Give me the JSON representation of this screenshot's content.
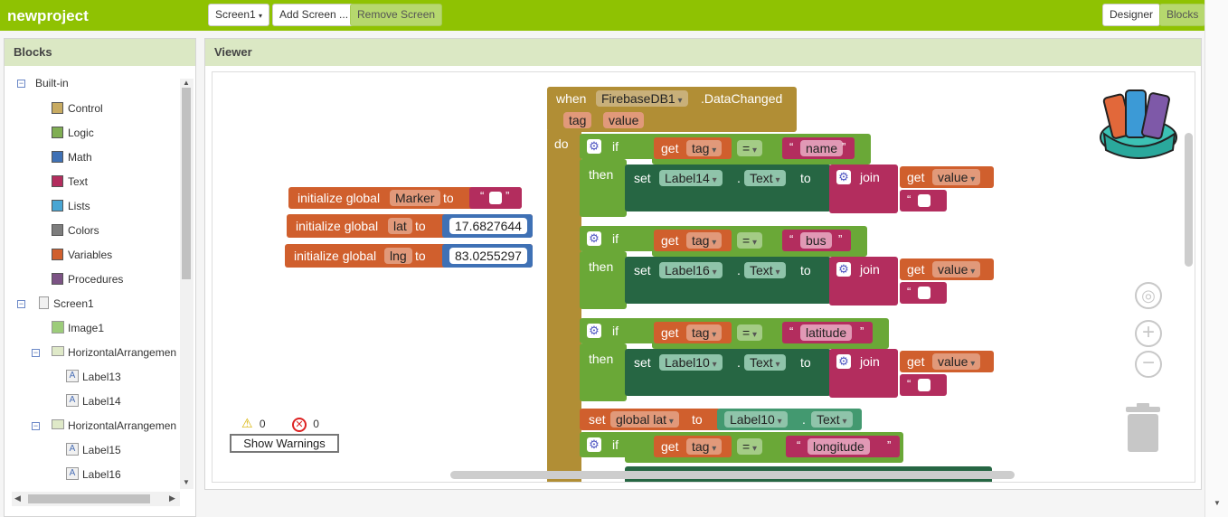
{
  "topbar": {
    "app_title": "newproject",
    "screen_select": "Screen1",
    "add_screen": "Add Screen ...",
    "remove_screen": "Remove Screen",
    "designer": "Designer",
    "blocks": "Blocks"
  },
  "blocks_panel": {
    "title": "Blocks",
    "builtin_label": "Built-in",
    "builtin_items": [
      {
        "label": "Control",
        "color": "#c8ab62"
      },
      {
        "label": "Logic",
        "color": "#80ae53"
      },
      {
        "label": "Math",
        "color": "#3f71b5"
      },
      {
        "label": "Text",
        "color": "#b32d5e"
      },
      {
        "label": "Lists",
        "color": "#49a6d4"
      },
      {
        "label": "Colors",
        "color": "#7d7d7d"
      },
      {
        "label": "Variables",
        "color": "#d05f2d"
      },
      {
        "label": "Procedures",
        "color": "#7c5385"
      }
    ],
    "components": {
      "screen": "Screen1",
      "image": "Image1",
      "arrangement1": "HorizontalArrangemen",
      "label13": "Label13",
      "label14": "Label14",
      "arrangement2": "HorizontalArrangemen",
      "label15": "Label15",
      "label16": "Label16"
    }
  },
  "viewer": {
    "title": "Viewer",
    "warnings_count": "0",
    "errors_count": "0",
    "show_warnings": "Show Warnings"
  },
  "globals": [
    {
      "kw": "initialize global",
      "name": "Marker",
      "to": "to"
    },
    {
      "kw": "initialize global",
      "name": "lat",
      "to": "to",
      "value": "17.6827644"
    },
    {
      "kw": "initialize global",
      "name": "lng",
      "to": "to",
      "value": "83.0255297"
    }
  ],
  "event": {
    "when": "when",
    "component": "FirebaseDB1",
    "event_name": ".DataChanged",
    "param_tag": "tag",
    "param_value": "value",
    "do": "do"
  },
  "kw": {
    "if": "if",
    "then": "then",
    "get": "get",
    "set": "set",
    "to": "to",
    "join": "join",
    "eq": "=",
    "dot": ".",
    "text_prop": "Text",
    "tag": "tag",
    "value": "value",
    "open_q": "“",
    "close_q": "”"
  },
  "if_blocks": [
    {
      "match": "name",
      "label": "Label14"
    },
    {
      "match": "bus",
      "label": "Label16"
    },
    {
      "match": "latitude",
      "label": "Label10"
    }
  ],
  "set_global": {
    "set": "set",
    "var": "global lat",
    "to": "to",
    "source": "Label10",
    "prop": "Text"
  },
  "last_if": {
    "match": "longitude"
  }
}
